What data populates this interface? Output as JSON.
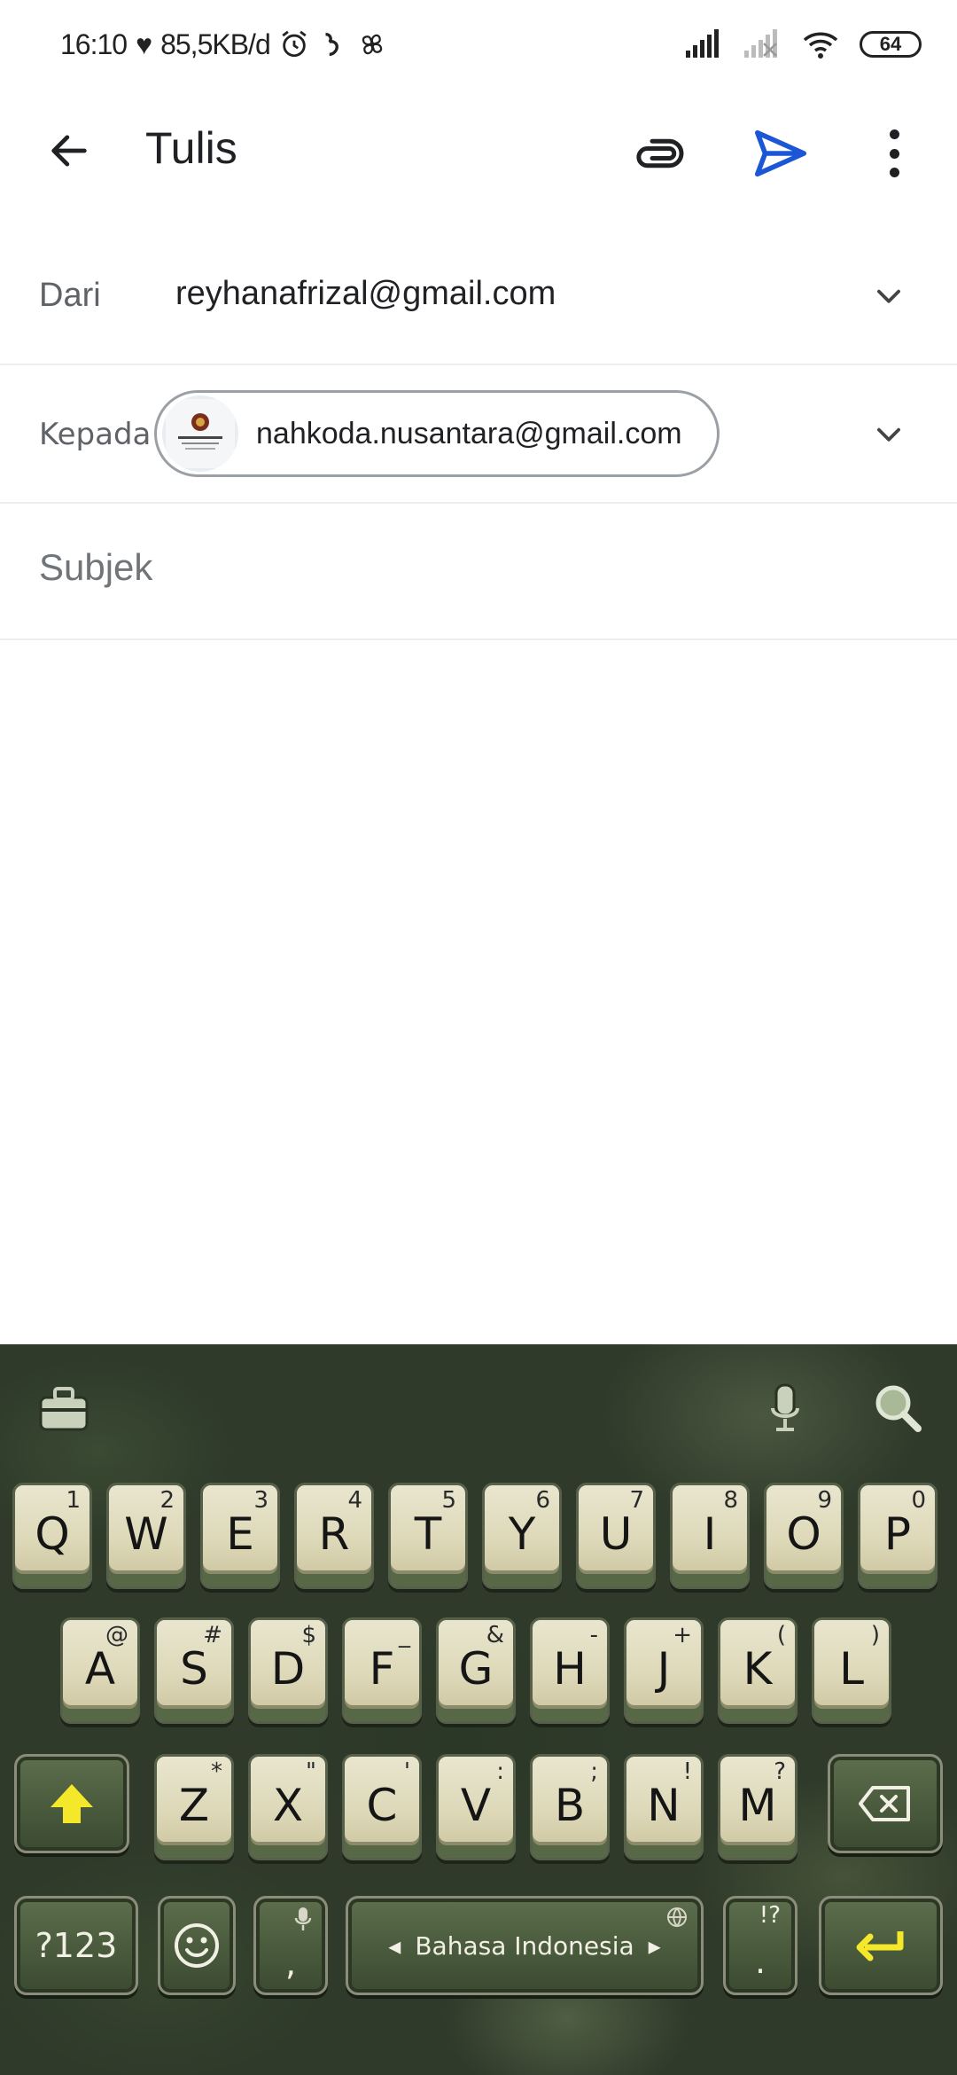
{
  "status_bar": {
    "time": "16:10",
    "speed": "85,5KB/d",
    "battery": "64"
  },
  "app_bar": {
    "title": "Tulis",
    "icons": [
      "back-arrow-icon",
      "attachment-icon",
      "send-icon",
      "more-vert-icon"
    ],
    "send_color": "#1a56d6"
  },
  "compose": {
    "from_label": "Dari",
    "from_value": "reyhanafrizal@gmail.com",
    "to_label": "Kepada",
    "to_chip": "nahkoda.nusantara@gmail.com",
    "subject_placeholder": "Subjek"
  },
  "keyboard": {
    "row1": [
      {
        "key": "Q",
        "hint": "1"
      },
      {
        "key": "W",
        "hint": "2"
      },
      {
        "key": "E",
        "hint": "3"
      },
      {
        "key": "R",
        "hint": "4"
      },
      {
        "key": "T",
        "hint": "5"
      },
      {
        "key": "Y",
        "hint": "6"
      },
      {
        "key": "U",
        "hint": "7"
      },
      {
        "key": "I",
        "hint": "8"
      },
      {
        "key": "O",
        "hint": "9"
      },
      {
        "key": "P",
        "hint": "0"
      }
    ],
    "row2": [
      {
        "key": "A",
        "hint": "@"
      },
      {
        "key": "S",
        "hint": "#"
      },
      {
        "key": "D",
        "hint": "$"
      },
      {
        "key": "F",
        "hint": "_"
      },
      {
        "key": "G",
        "hint": "&"
      },
      {
        "key": "H",
        "hint": "-"
      },
      {
        "key": "J",
        "hint": "+"
      },
      {
        "key": "K",
        "hint": "("
      },
      {
        "key": "L",
        "hint": ")"
      }
    ],
    "row3": [
      {
        "key": "Z",
        "hint": "*"
      },
      {
        "key": "X",
        "hint": "\""
      },
      {
        "key": "C",
        "hint": "'"
      },
      {
        "key": "V",
        "hint": ":"
      },
      {
        "key": "B",
        "hint": ";"
      },
      {
        "key": "N",
        "hint": "!"
      },
      {
        "key": "M",
        "hint": "?"
      }
    ],
    "symbols_label": "?123",
    "comma": ",",
    "period": ".",
    "space_label": "Bahasa Indonesia",
    "shift_color": "#f5e82a",
    "enter_color": "#f5e82a"
  }
}
